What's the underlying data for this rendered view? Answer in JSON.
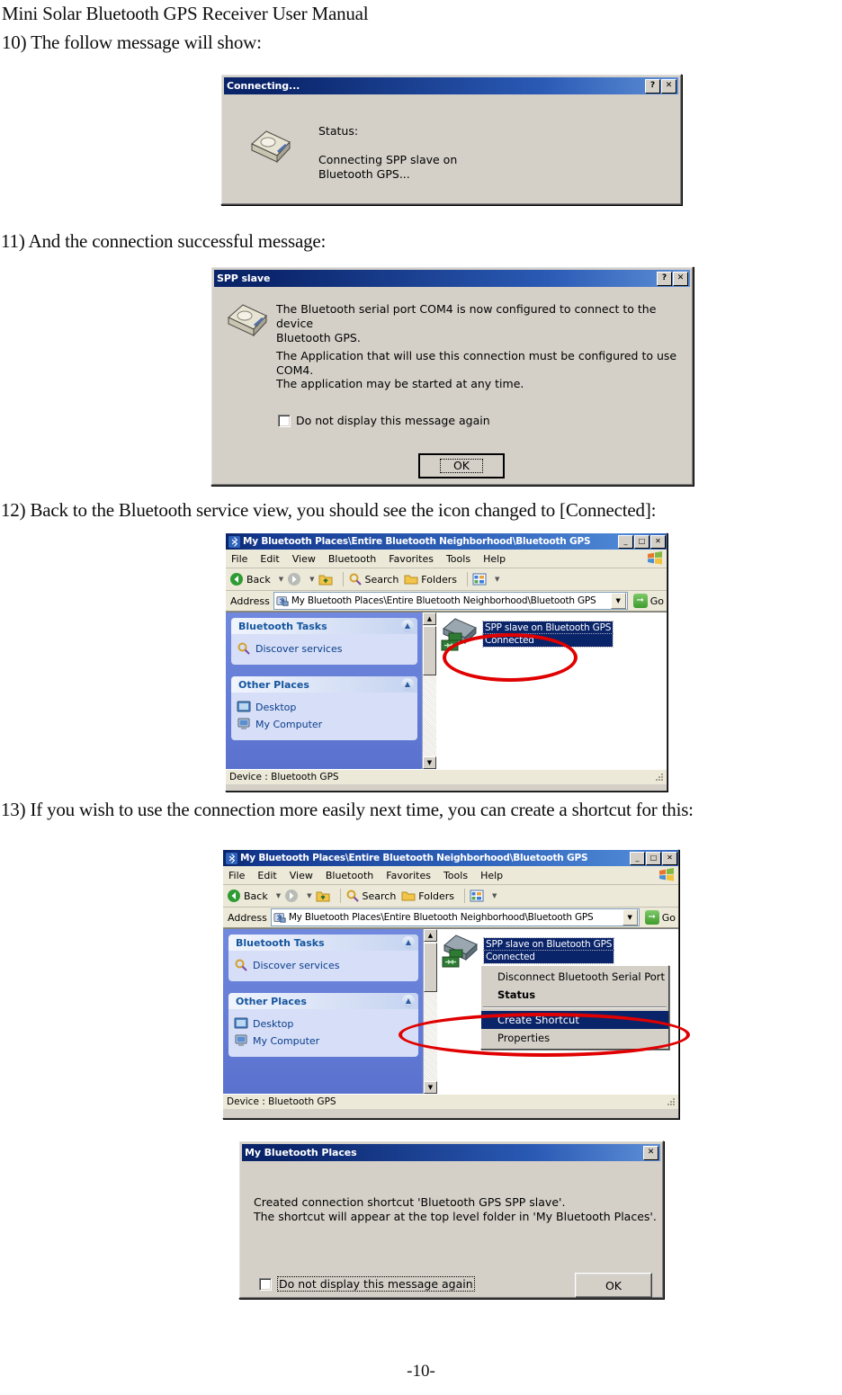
{
  "document": {
    "header": "Mini Solar Bluetooth GPS Receiver User Manual",
    "step_10": "10) The follow message will show:",
    "step_11": "11) And the connection successful message:",
    "step_12": "12) Back to the Bluetooth service view, you should see the icon changed to [Connected]:",
    "step_13": "13) If you wish to use the connection more easily next time, you can create a shortcut for this:",
    "footer": "-10-"
  },
  "colors": {
    "titlebar_start": "#0a246a",
    "titlebar_end": "#5e8fd6",
    "selection": "#0a246a",
    "annotation_red": "#e00000",
    "dialog_face": "#d4d0c8",
    "explorer_sidebar": "#6375d6",
    "panel_face": "#d6dff7",
    "panel_link": "#0b3c8c"
  },
  "connecting_dialog": {
    "title": "Connecting...",
    "help_button": "?",
    "close_button": "✕",
    "icon": "serial-port-connector-icon",
    "status_label": "Status:",
    "status_text": "Connecting SPP slave on\nBluetooth GPS..."
  },
  "spp_dialog": {
    "title": "SPP slave",
    "help_button": "?",
    "close_button": "✕",
    "icon": "serial-port-connector-icon",
    "line_1": "The Bluetooth serial port COM4 is now configured to connect to the device\nBluetooth GPS.",
    "line_2": "The Application that will use this connection must be configured to use COM4.",
    "line_3": "The application may be started at any time.",
    "checkbox_label": "Do not display this message again",
    "checkbox_checked": false,
    "ok_button": "OK"
  },
  "explorer_1": {
    "title": "My Bluetooth Places\\Entire Bluetooth Neighborhood\\Bluetooth GPS",
    "window_buttons": {
      "minimize": "_",
      "maximize": "□",
      "close": "✕"
    },
    "menus": [
      "File",
      "Edit",
      "View",
      "Bluetooth",
      "Favorites",
      "Tools",
      "Help"
    ],
    "toolbar": {
      "back": "Back",
      "forward": "",
      "up": "up-folder-icon",
      "search": "Search",
      "folders": "Folders",
      "views": "views-icon"
    },
    "address": {
      "label": "Address",
      "value": "My Bluetooth Places\\Entire Bluetooth Neighborhood\\Bluetooth GPS",
      "go_label": "Go"
    },
    "sidebar": {
      "panels": [
        {
          "title": "Bluetooth Tasks",
          "items": [
            {
              "icon": "magnifier-icon",
              "label": "Discover services"
            }
          ]
        },
        {
          "title": "Other Places",
          "items": [
            {
              "icon": "desktop-icon",
              "label": "Desktop"
            },
            {
              "icon": "my-computer-icon",
              "label": "My Computer"
            }
          ]
        }
      ]
    },
    "item": {
      "icon": "bluetooth-serial-port-connected-icon",
      "line_1": "SPP slave on Bluetooth GPS",
      "line_2": "Connected"
    },
    "status": "Device : Bluetooth GPS"
  },
  "explorer_2": {
    "title": "My Bluetooth Places\\Entire Bluetooth Neighborhood\\Bluetooth GPS",
    "window_buttons": {
      "minimize": "_",
      "maximize": "□",
      "close": "✕"
    },
    "menus": [
      "File",
      "Edit",
      "View",
      "Bluetooth",
      "Favorites",
      "Tools",
      "Help"
    ],
    "toolbar": {
      "back": "Back",
      "forward": "",
      "up": "up-folder-icon",
      "search": "Search",
      "folders": "Folders",
      "views": "views-icon"
    },
    "address": {
      "label": "Address",
      "value": "My Bluetooth Places\\Entire Bluetooth Neighborhood\\Bluetooth GPS",
      "go_label": "Go"
    },
    "sidebar": {
      "panels": [
        {
          "title": "Bluetooth Tasks",
          "items": [
            {
              "icon": "magnifier-icon",
              "label": "Discover services"
            }
          ]
        },
        {
          "title": "Other Places",
          "items": [
            {
              "icon": "desktop-icon",
              "label": "Desktop"
            },
            {
              "icon": "my-computer-icon",
              "label": "My Computer"
            }
          ]
        }
      ]
    },
    "item": {
      "icon": "bluetooth-serial-port-connected-icon",
      "line_1": "SPP slave on Bluetooth GPS",
      "line_2": "Connected"
    },
    "context_menu": [
      {
        "label": "Disconnect Bluetooth Serial Port",
        "bold": false,
        "selected": false
      },
      {
        "label": "Status",
        "bold": true,
        "selected": false
      },
      {
        "separator": true
      },
      {
        "label": "Create Shortcut",
        "bold": false,
        "selected": true
      },
      {
        "label": "Properties",
        "bold": false,
        "selected": false
      }
    ],
    "status": "Device : Bluetooth GPS"
  },
  "shortcut_dialog": {
    "title": "My Bluetooth Places",
    "close_button": "✕",
    "message": "Created connection shortcut 'Bluetooth GPS SPP slave'.\nThe shortcut will appear at the top level folder in 'My Bluetooth Places'.",
    "checkbox_label": "Do not display this message again",
    "checkbox_checked": false,
    "ok_button": "OK"
  }
}
